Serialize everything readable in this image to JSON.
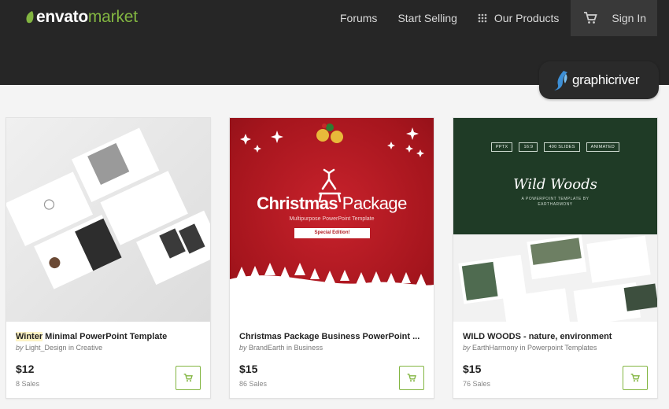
{
  "header": {
    "logo_envato": "envato",
    "logo_market": "market",
    "nav": [
      "Forums",
      "Start Selling",
      "Our Products"
    ],
    "signin_label": "Sign In",
    "badge_text": "graphicriver"
  },
  "colors": {
    "accent_green": "#82b541",
    "topbar_bg": "#262626",
    "xmas_red": "#b11b22",
    "woods_green": "#1f3b26"
  },
  "cards": [
    {
      "title_highlight": "Winter",
      "title_rest": " Minimal PowerPoint Template",
      "by_prefix": "by",
      "author": " Light_Design in Creative",
      "price": "$12",
      "sales": "8 Sales"
    },
    {
      "title": "Christmas Package Business PowerPoint ...",
      "by_prefix": "by",
      "author": " BrandEarth in Business",
      "price": "$15",
      "sales": "86 Sales",
      "thumb_title_a": "Christmas",
      "thumb_title_b": " Package",
      "thumb_sub": "Multipurpose PowerPoint Template",
      "thumb_ribbon": "Special Edition!"
    },
    {
      "title": "WILD WOODS - nature, environment",
      "by_prefix": "by",
      "author": " EarthHarmony in Powerpoint Templates",
      "price": "$15",
      "sales": "76 Sales",
      "thumb_tags": [
        "PPTX",
        "16:9",
        "400 SLIDES",
        "ANIMATED"
      ],
      "thumb_title": "Wild Woods",
      "thumb_sub": "A POWERPOINT TEMPLATE BY",
      "thumb_by": "EARTHARMONY"
    }
  ],
  "icons": {
    "cart": "cart-icon",
    "grid": "grid-icon",
    "logo": "leaf-icon",
    "badge": "graphicriver-icon"
  }
}
